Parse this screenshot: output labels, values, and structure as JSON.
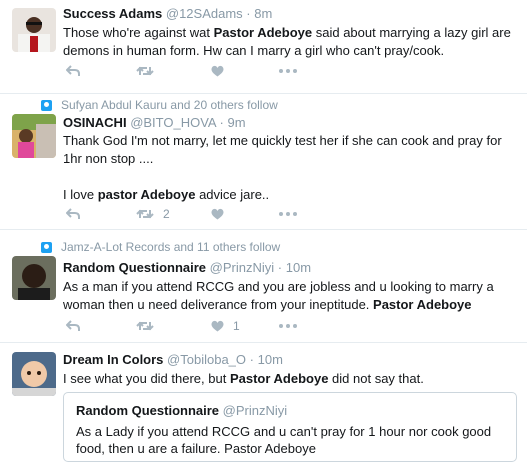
{
  "tweets": [
    {
      "name": "Success Adams",
      "handle": "@12SAdams",
      "sep": "·",
      "time": "8m",
      "text_1": "Those who're against wat ",
      "text_bold_1": "Pastor Adeboye",
      "text_2": " said about marrying a lazy girl are demons in human form. Hw can I marry a girl who can't pray/cook."
    },
    {
      "social": "Sufyan Abdul Kauru and 20 others follow",
      "name": "OSINACHI",
      "handle": "@BITO_HOVA",
      "sep": "·",
      "time": "9m",
      "text_1": "Thank God I'm not marry, let me quickly test her if she can cook and pray for 1hr non stop ....",
      "text_2": "I love ",
      "text_bold_1": "pastor Adeboye",
      "text_3": " advice jare..",
      "retweets": "2"
    },
    {
      "social": "Jamz-A-Lot Records and 11 others follow",
      "name": "Random Questionnaire",
      "handle": "@PrinzNiyi",
      "sep": "·",
      "time": "10m",
      "text_1": "As a man if you attend RCCG and you are jobless and u looking to marry a woman then u need deliverance from your ineptitude. ",
      "text_bold_1": "Pastor Adeboye",
      "likes": "1"
    },
    {
      "name": "Dream In Colors",
      "handle": "@Tobiloba_O",
      "sep": "·",
      "time": "10m",
      "text_1": "I see what you did there, but ",
      "text_bold_1": "Pastor Adeboye",
      "text_2": " did not say that.",
      "quote": {
        "name": "Random Questionnaire",
        "handle": "@PrinzNiyi",
        "text": "As a Lady if you attend RCCG and u can't pray for 1 hour nor cook good food, then u are a failure. Pastor Adeboye"
      }
    }
  ],
  "colors": {
    "name": "#14171a",
    "meta": "#8899a6",
    "icon": "#aab8c2",
    "follow": "#1da1f2",
    "border": "#e6ecf0"
  },
  "icons": [
    "reply-icon",
    "retweet-icon",
    "like-icon",
    "more-icon",
    "follow-badge-icon"
  ]
}
